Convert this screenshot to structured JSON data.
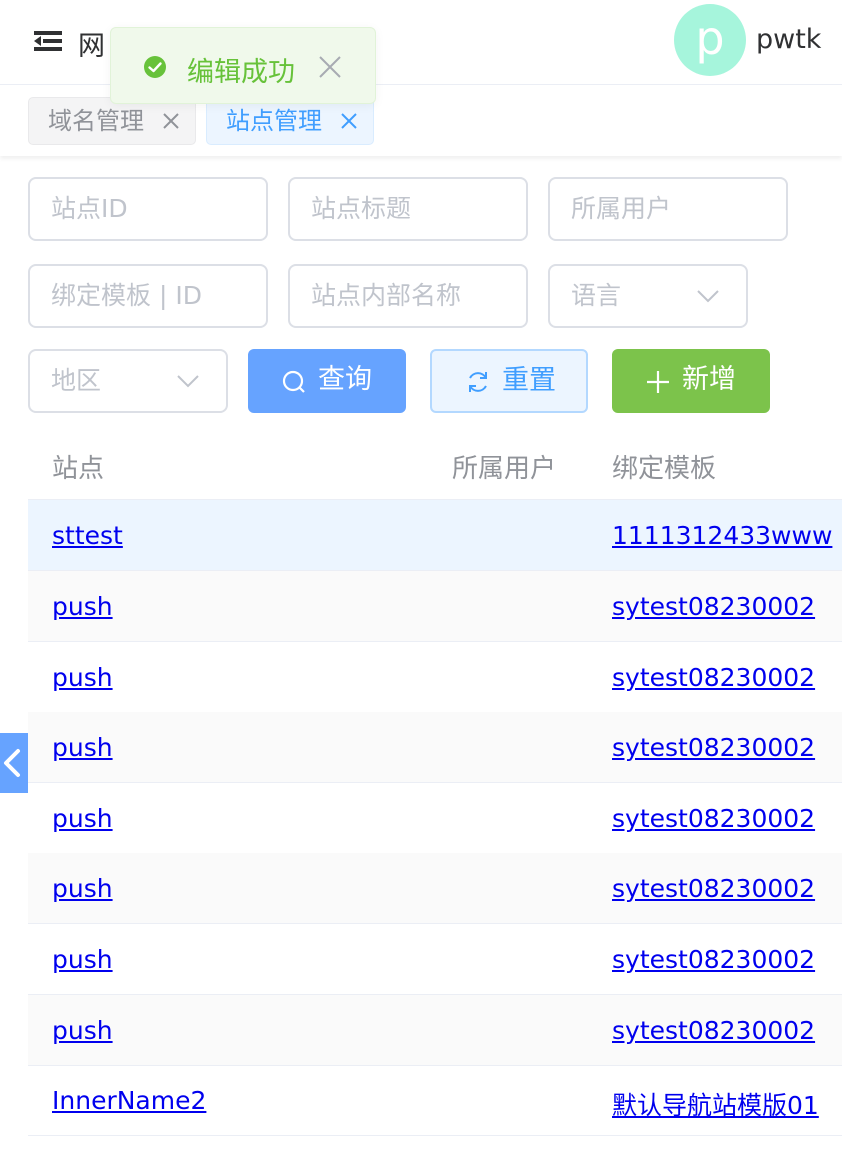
{
  "header": {
    "brand": "网",
    "avatar_letter": "p",
    "username": "pwtk"
  },
  "toast": {
    "text": "编辑成功",
    "type": "success"
  },
  "tags": [
    {
      "label": "域名管理",
      "active": false
    },
    {
      "label": "站点管理",
      "active": true
    }
  ],
  "filters": {
    "site_id_placeholder": "站点ID",
    "site_title_placeholder": "站点标题",
    "owner_placeholder": "所属用户",
    "template_placeholder": "绑定模板 | ID",
    "inner_name_placeholder": "站点内部名称",
    "language_placeholder": "语言",
    "region_placeholder": "地区"
  },
  "buttons": {
    "query": "查询",
    "reset": "重置",
    "add": "新增"
  },
  "table": {
    "columns": [
      "站点",
      "所属用户",
      "绑定模板"
    ],
    "rows": [
      {
        "site": "sttest",
        "owner": "",
        "template": "1111312433www"
      },
      {
        "site": "push",
        "owner": "",
        "template": "sytest08230002"
      },
      {
        "site": "push",
        "owner": "",
        "template": "sytest08230002"
      },
      {
        "site": "push",
        "owner": "",
        "template": "sytest08230002"
      },
      {
        "site": "push",
        "owner": "",
        "template": "sytest08230002"
      },
      {
        "site": "push",
        "owner": "",
        "template": "sytest08230002"
      },
      {
        "site": "push",
        "owner": "",
        "template": "sytest08230002"
      },
      {
        "site": "push",
        "owner": "",
        "template": "sytest08230002"
      },
      {
        "site": "InnerName2",
        "owner": "",
        "template": "默认导航站模版01"
      }
    ]
  },
  "colors": {
    "primary": "#409eff",
    "success": "#67c23a",
    "add_button": "#7cc34b",
    "query_button": "#66a3ff"
  }
}
